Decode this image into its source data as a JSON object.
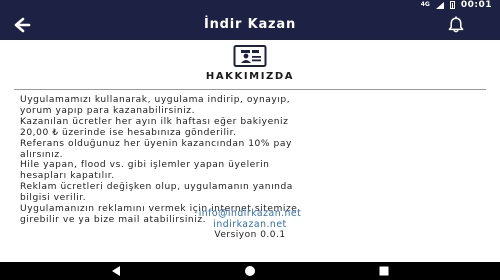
{
  "status_bar": {
    "network": "4G",
    "time": "00:01",
    "icons": [
      "signal-icon",
      "battery-icon"
    ]
  },
  "app_bar": {
    "title": "İndir Kazan",
    "back_icon": "arrow-left-icon",
    "bell_icon": "bell-icon"
  },
  "header": {
    "icon": "id-card-icon",
    "title": "HAKKIMIZDA"
  },
  "about": {
    "lines": [
      "Uygulamamızı kullanarak, uygulama indirip, oynayıp,",
      "yorum yapıp para kazanabilirsiniz.",
      "Kazanılan ücretler her ayın ilk haftası eğer bakiyeniz",
      "20,00 ₺ üzerinde ise hesabınıza gönderilir.",
      "Referans olduğunuz her üyenin kazancından 10% pay",
      "alırsınız.",
      "Hile yapan, flood vs. gibi işlemler yapan üyelerin",
      "hesapları kapatılır.",
      "Reklam ücretleri değişken olup, uygulamanın yanında",
      "bilgisi verilir.",
      "Uygulamanızın reklamını vermek için internet sitemize",
      "girebilir ve ya bize mail atabilirsiniz."
    ]
  },
  "footer": {
    "email": "info@indirkazan.net",
    "website": "indirkazan.net",
    "version": "Versiyon 0.0.1"
  },
  "nav_bar": {
    "icons": [
      "back-triangle-icon",
      "home-circle-icon",
      "recents-square-icon"
    ]
  },
  "colors": {
    "primary": "#1d2244",
    "link": "#2f6fb3",
    "background": "#ffffff"
  }
}
